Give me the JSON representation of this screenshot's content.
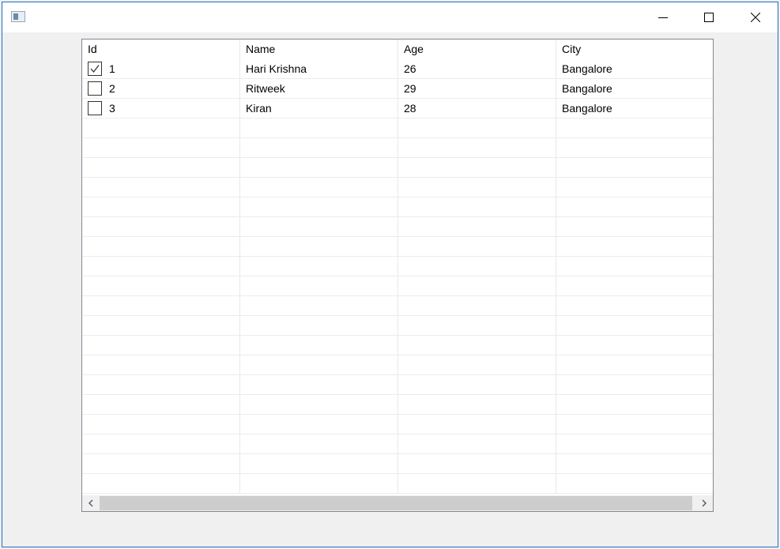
{
  "window": {
    "title": "",
    "icon": "app-window-icon",
    "controls": [
      "minimize-icon",
      "maximize-icon",
      "close-icon"
    ]
  },
  "grid": {
    "columns": [
      "Id",
      "Name",
      "Age",
      "City"
    ],
    "rows": [
      {
        "checked": true,
        "id": "1",
        "name": "Hari Krishna",
        "age": "26",
        "city": "Bangalore"
      },
      {
        "checked": false,
        "id": "2",
        "name": "Ritweek",
        "age": "29",
        "city": "Bangalore"
      },
      {
        "checked": false,
        "id": "3",
        "name": "Kiran",
        "age": "28",
        "city": "Bangalore"
      }
    ],
    "empty_row_count": 19
  },
  "colors": {
    "window_border": "#1e6fc4",
    "grid_border": "#828790",
    "grid_lines": "#e8e8e8",
    "scroll_thumb": "#cdcdcd"
  }
}
